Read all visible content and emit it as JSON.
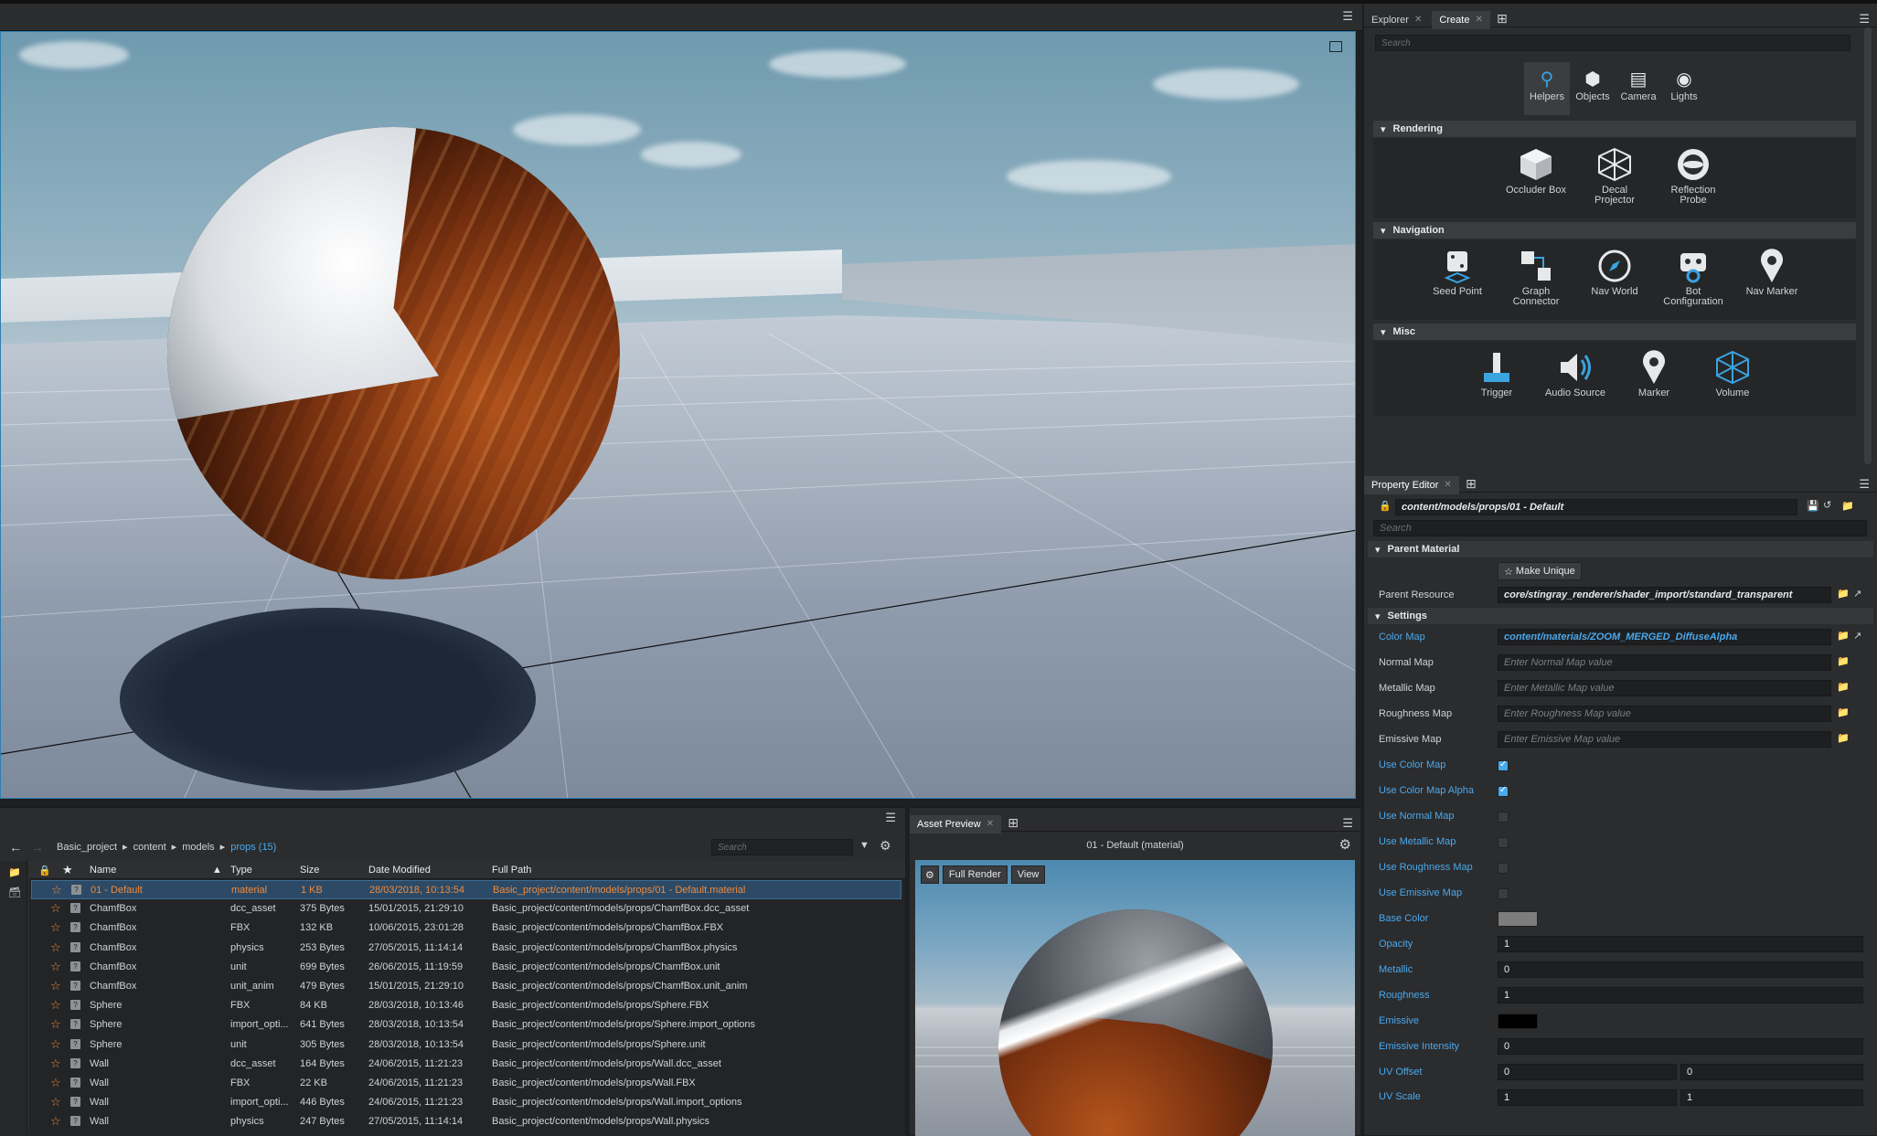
{
  "create_panel": {
    "tabs": [
      {
        "label": "Explorer"
      },
      {
        "label": "Create"
      }
    ],
    "search_placeholder": "Search",
    "categories": [
      {
        "label": "Helpers",
        "icon": "map-pin-icon"
      },
      {
        "label": "Objects",
        "icon": "cube-icon"
      },
      {
        "label": "Camera",
        "icon": "camera-icon"
      },
      {
        "label": "Lights",
        "icon": "lightbulb-icon"
      }
    ],
    "sections": [
      {
        "title": "Rendering",
        "items": [
          {
            "line1": "Occluder Box",
            "line2": "",
            "icon": "occluder-box-icon"
          },
          {
            "line1": "Decal",
            "line2": "Projector",
            "icon": "decal-projector-icon"
          },
          {
            "line1": "Reflection",
            "line2": "Probe",
            "icon": "reflection-probe-icon"
          }
        ]
      },
      {
        "title": "Navigation",
        "items": [
          {
            "line1": "Seed Point",
            "line2": "",
            "icon": "seed-point-icon"
          },
          {
            "line1": "Graph",
            "line2": "Connector",
            "icon": "graph-connector-icon"
          },
          {
            "line1": "Nav World",
            "line2": "",
            "icon": "nav-world-icon"
          },
          {
            "line1": "Bot",
            "line2": "Configuration",
            "icon": "bot-configuration-icon"
          },
          {
            "line1": "Nav Marker",
            "line2": "",
            "icon": "nav-marker-icon"
          }
        ]
      },
      {
        "title": "Misc",
        "items": [
          {
            "line1": "Trigger",
            "line2": "",
            "icon": "trigger-icon"
          },
          {
            "line1": "Audio Source",
            "line2": "",
            "icon": "audio-source-icon"
          },
          {
            "line1": "Marker",
            "line2": "",
            "icon": "marker-icon"
          },
          {
            "line1": "Volume",
            "line2": "",
            "icon": "volume-icon"
          }
        ]
      }
    ]
  },
  "property_editor": {
    "tab_label": "Property Editor",
    "path": "content/models/props/01 - Default",
    "search_placeholder": "Search",
    "parent_material_title": "Parent Material",
    "make_unique_label": "Make Unique",
    "parent_resource_label": "Parent Resource",
    "parent_resource_value": "core/stingray_renderer/shader_import/standard_transparent",
    "settings_title": "Settings",
    "maps": [
      {
        "label": "Color Map",
        "value": "content/materials/ZOOM_MERGED_DiffuseAlpha",
        "set": true
      },
      {
        "label": "Normal Map",
        "value": "Enter Normal Map value",
        "set": false
      },
      {
        "label": "Metallic Map",
        "value": "Enter Metallic Map value",
        "set": false
      },
      {
        "label": "Roughness Map",
        "value": "Enter Roughness Map value",
        "set": false
      },
      {
        "label": "Emissive Map",
        "value": "Enter Emissive Map value",
        "set": false
      }
    ],
    "toggles": [
      {
        "label": "Use Color Map",
        "checked": true
      },
      {
        "label": "Use Color Map Alpha",
        "checked": true
      },
      {
        "label": "Use Normal Map",
        "checked": false
      },
      {
        "label": "Use Metallic Map",
        "checked": false
      },
      {
        "label": "Use Roughness Map",
        "checked": false
      },
      {
        "label": "Use Emissive Map",
        "checked": false
      }
    ],
    "base_color_label": "Base Color",
    "base_color": "#7d7d7d",
    "numbers": [
      {
        "label": "Opacity",
        "value": "1"
      },
      {
        "label": "Metallic",
        "value": "0"
      },
      {
        "label": "Roughness",
        "value": "1"
      }
    ],
    "emissive_label": "Emissive",
    "emissive_color": "#000000",
    "emissive_intensity_label": "Emissive Intensity",
    "emissive_intensity_value": "0",
    "uv_offset_label": "UV Offset",
    "uv_offset": [
      "0",
      "0"
    ],
    "uv_scale_label": "UV Scale",
    "uv_scale": [
      "1",
      "1"
    ]
  },
  "asset_browser": {
    "breadcrumb": [
      "Basic_project",
      "content",
      "models"
    ],
    "current_folder": "props (15)",
    "search_placeholder": "Search",
    "columns": [
      "Name",
      "Type",
      "Size",
      "Date Modified",
      "Full Path"
    ],
    "rows": [
      {
        "name": "01 - Default",
        "type": "material",
        "size": "1 KB",
        "date": "28/03/2018, 10:13:54",
        "path": "Basic_project/content/models/props/01 - Default.material",
        "selected": true
      },
      {
        "name": "ChamfBox",
        "type": "dcc_asset",
        "size": "375 Bytes",
        "date": "15/01/2015, 21:29:10",
        "path": "Basic_project/content/models/props/ChamfBox.dcc_asset"
      },
      {
        "name": "ChamfBox",
        "type": "FBX",
        "size": "132 KB",
        "date": "10/06/2015, 23:01:28",
        "path": "Basic_project/content/models/props/ChamfBox.FBX"
      },
      {
        "name": "ChamfBox",
        "type": "physics",
        "size": "253 Bytes",
        "date": "27/05/2015, 11:14:14",
        "path": "Basic_project/content/models/props/ChamfBox.physics"
      },
      {
        "name": "ChamfBox",
        "type": "unit",
        "size": "699 Bytes",
        "date": "26/06/2015, 11:19:59",
        "path": "Basic_project/content/models/props/ChamfBox.unit"
      },
      {
        "name": "ChamfBox",
        "type": "unit_anim",
        "size": "479 Bytes",
        "date": "15/01/2015, 21:29:10",
        "path": "Basic_project/content/models/props/ChamfBox.unit_anim"
      },
      {
        "name": "Sphere",
        "type": "FBX",
        "size": "84 KB",
        "date": "28/03/2018, 10:13:46",
        "path": "Basic_project/content/models/props/Sphere.FBX"
      },
      {
        "name": "Sphere",
        "type": "import_opti...",
        "size": "641 Bytes",
        "date": "28/03/2018, 10:13:54",
        "path": "Basic_project/content/models/props/Sphere.import_options"
      },
      {
        "name": "Sphere",
        "type": "unit",
        "size": "305 Bytes",
        "date": "28/03/2018, 10:13:54",
        "path": "Basic_project/content/models/props/Sphere.unit"
      },
      {
        "name": "Wall",
        "type": "dcc_asset",
        "size": "164 Bytes",
        "date": "24/06/2015, 11:21:23",
        "path": "Basic_project/content/models/props/Wall.dcc_asset"
      },
      {
        "name": "Wall",
        "type": "FBX",
        "size": "22 KB",
        "date": "24/06/2015, 11:21:23",
        "path": "Basic_project/content/models/props/Wall.FBX"
      },
      {
        "name": "Wall",
        "type": "import_opti...",
        "size": "446 Bytes",
        "date": "24/06/2015, 11:21:23",
        "path": "Basic_project/content/models/props/Wall.import_options"
      },
      {
        "name": "Wall",
        "type": "physics",
        "size": "247 Bytes",
        "date": "27/05/2015, 11:14:14",
        "path": "Basic_project/content/models/props/Wall.physics"
      }
    ]
  },
  "asset_preview": {
    "tab_label": "Asset Preview",
    "title": "01 - Default (material)",
    "full_render_label": "Full Render",
    "view_label": "View"
  },
  "colors": {
    "accent": "#4aa8ec",
    "selection": "#f08a3c",
    "panel": "#2b2c2e"
  }
}
